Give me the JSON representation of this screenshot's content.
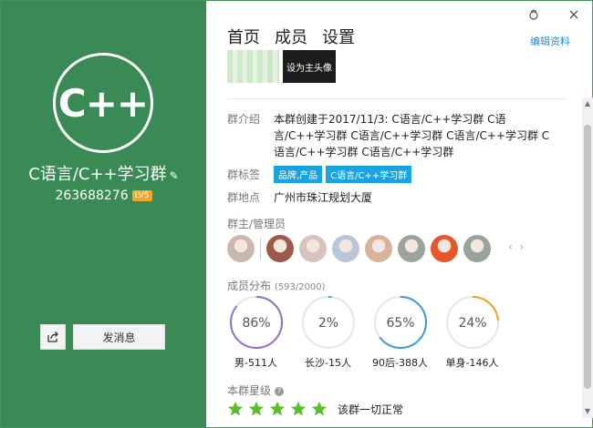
{
  "group": {
    "logo_text": "C++",
    "name": "C语言/C++学习群",
    "edit_glyph": "✎",
    "id": "263688276",
    "level": "LV5"
  },
  "left_buttons": {
    "share_icon": "share-icon",
    "send_message": "发消息"
  },
  "window_controls": [
    "skin-icon",
    "close-icon"
  ],
  "tabs": [
    {
      "label": "首页",
      "active": true
    },
    {
      "label": "成员",
      "active": false
    },
    {
      "label": "设置",
      "active": false
    }
  ],
  "edit_profile": "编辑资料",
  "thumbnail_set_avatar": "设为主头像",
  "intro": {
    "label": "群介绍",
    "text": "本群创建于2017/11/3:  C语言/C++学习群 C语言/C++学习群 C语言/C++学习群 C语言/C++学习群 C语言/C++学习群 C语言/C++学习群"
  },
  "tags": {
    "label": "群标签",
    "items": [
      "品牌,产品",
      "C语言/C++学习群"
    ]
  },
  "location": {
    "label": "群地点",
    "value": "广州市珠江规划大厦"
  },
  "admins": {
    "label": "群主/管理员",
    "avatar_colors": [
      "#c9b8b0",
      "#9c5a4a",
      "#d8c2c0",
      "#b9c6d8",
      "#d6b39a",
      "#9aa49a",
      "#e8572a",
      "#9aa39a"
    ]
  },
  "distribution": {
    "label": "成员分布",
    "count": "(593/2000)",
    "rings": [
      {
        "percent": 86,
        "display": "86%",
        "label": "男-511人",
        "color": "#8f6fd0"
      },
      {
        "percent": 2,
        "display": "2%",
        "label": "长沙-15人",
        "color": "#4cb85a"
      },
      {
        "percent": 65,
        "display": "65%",
        "label": "90后-388人",
        "color": "#3a9bd8"
      },
      {
        "percent": 24,
        "display": "24%",
        "label": "单身-146人",
        "color": "#f0a020"
      }
    ]
  },
  "rating": {
    "label": "本群星级",
    "help": "?",
    "stars": 5,
    "star_color": "#5bbf2a",
    "note": "该群一切正常"
  }
}
